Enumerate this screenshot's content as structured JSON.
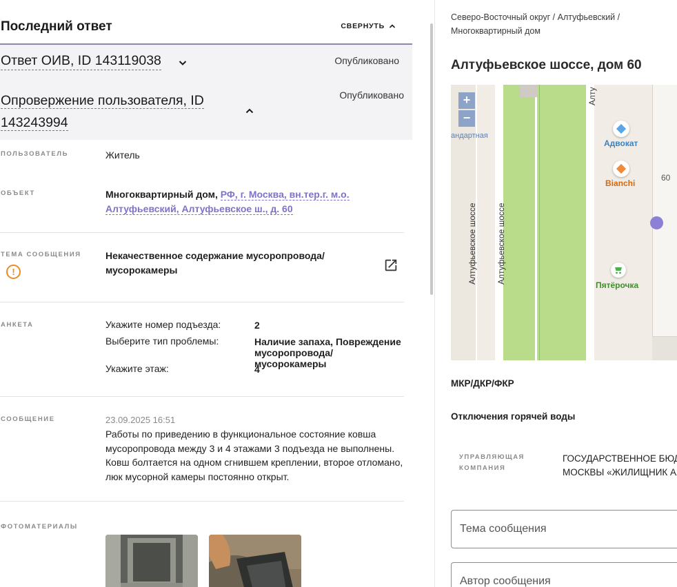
{
  "last_answer": {
    "title": "Последний ответ",
    "collapse_label": "СВЕРНУТЬ"
  },
  "oiv": {
    "title": "Ответ ОИВ, ID 143119038",
    "status": "Опубликовано"
  },
  "refute": {
    "title": "Опровержение пользователя, ID 143243994",
    "status": "Опубликовано"
  },
  "details": {
    "user_label": "ПОЛЬЗОВАТЕЛЬ",
    "user_value": "Житель",
    "object_label": "ОБЪЕКТ",
    "object_type": "Многоквартирный дом,",
    "object_address": "РФ, г. Москва, вн.тер.г. м.о. Алтуфьевский, Алтуфьевское ш., д. 60",
    "topic_label": "ТЕМА СООБЩЕНИЯ",
    "topic_value": "Некачественное содержание мусоропровода/ мусорокамеры",
    "form_label": "АНКЕТА",
    "form": [
      {
        "q": "Укажите номер подъезда:",
        "a": "2"
      },
      {
        "q": "Выберите тип проблемы:",
        "a": "Наличие запаха, Повреждение мусоропровода/мусорокамеры"
      },
      {
        "q": "Укажите этаж:",
        "a": "4"
      }
    ],
    "message_label": "СООБЩЕНИЕ",
    "message_date": "23.09.2025 16:51",
    "message_text": "Работы по приведению в функциональное состояние ковша мусоропровода между 3 и 4 этажами 3 подъезда не выполнены. Ковш болтается на одном сгнившем креплении, второе отломано, люк мусорной камеры постоянно открыт.",
    "photos_label": "ФОТОМАТЕРИАЛЫ"
  },
  "right": {
    "breadcrumb": "Северо-Восточный округ / Алтуфьевский / Многоквартирный дом",
    "address": "Алтуфьевское шоссе, дом 60",
    "map": {
      "zoom_in": "+",
      "zoom_out": "−",
      "layer_label": "андартная",
      "street_1": "Алтуфьевское шоссе",
      "street_2": "Алтуфьевское шоссе",
      "street_top": "Алту",
      "poi_advokat": "Адвокат",
      "poi_bianchi": "Bianchi",
      "poi_pyaterochka": "Пятёрочка",
      "house_number": "60",
      "colors": {
        "green": "#b9dc8a",
        "road": "#ffffff",
        "marker": "#8b7fd6"
      }
    },
    "mkr_heading": "МКР/ДКР/ФКР",
    "hot_water_heading": "Отключения горячей воды",
    "uk_label": "УПРАВЛЯЮЩАЯ КОМПАНИЯ",
    "uk_value_line1": "ГОСУДАРСТВЕННОЕ БЮДЖ",
    "uk_value_line2": "МОСКВЫ «ЖИЛИЩНИК АЛ",
    "field_topic_placeholder": "Тема сообщения",
    "field_author_placeholder": "Автор сообщения"
  }
}
